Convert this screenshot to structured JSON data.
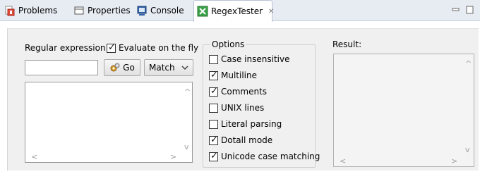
{
  "tabs": [
    {
      "label": "Problems",
      "icon": "problems-icon"
    },
    {
      "label": "Properties",
      "icon": "properties-icon"
    },
    {
      "label": "Console",
      "icon": "console-icon"
    },
    {
      "label": "RegexTester",
      "icon": "regex-tester-icon",
      "active": true,
      "close": "✕"
    }
  ],
  "regex": {
    "label": "Regular expression:",
    "evaluate_label": "Evaluate on the fly",
    "evaluate_checked": true,
    "input_value": "",
    "go_label": "Go",
    "mode_value": "Match"
  },
  "options": {
    "title": "Options",
    "items": [
      {
        "label": "Case insensitive",
        "checked": false
      },
      {
        "label": "Multiline",
        "checked": true
      },
      {
        "label": "Comments",
        "checked": true
      },
      {
        "label": "UNIX lines",
        "checked": false
      },
      {
        "label": "Literal parsing",
        "checked": false
      },
      {
        "label": "Dotall mode",
        "checked": true
      },
      {
        "label": "Unicode case matching",
        "checked": true
      }
    ]
  },
  "result": {
    "label": "Result:"
  },
  "colors": {
    "tab_bar": "#e7ecf3",
    "panel": "#f0f0f0",
    "regex_icon_green": "#3aa14a"
  }
}
